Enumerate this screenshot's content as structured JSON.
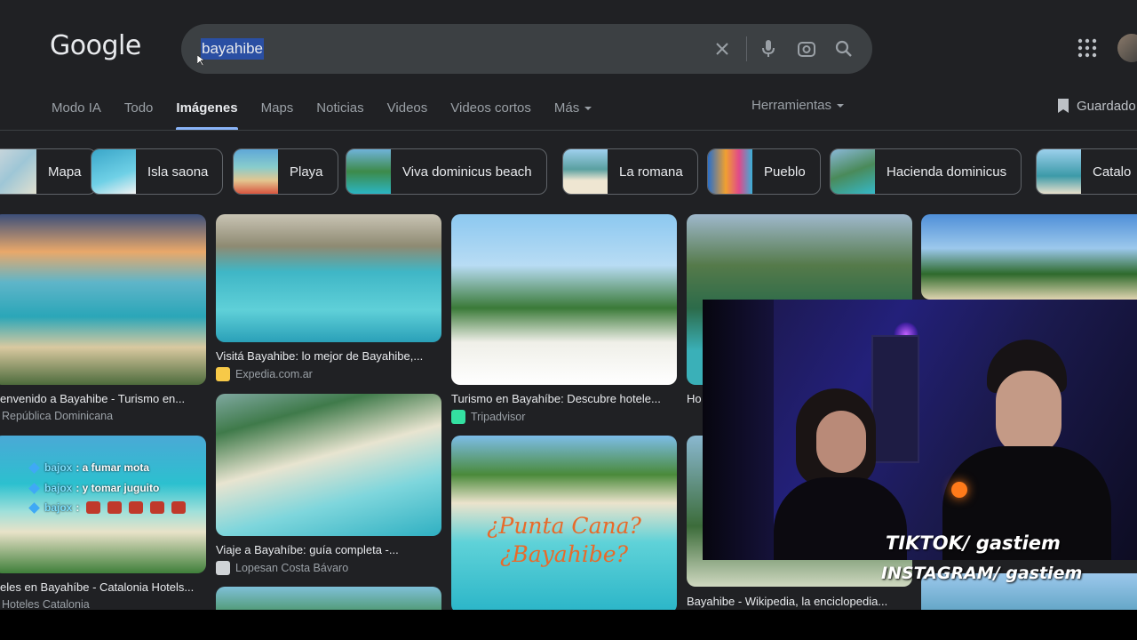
{
  "header": {
    "logo": "Google",
    "search_query": "bayahibe",
    "icons": [
      "close-icon",
      "mic-icon",
      "lens-icon",
      "search-icon",
      "apps-grid-icon"
    ]
  },
  "tabs": [
    {
      "label": "Modo IA",
      "active": false
    },
    {
      "label": "Todo",
      "active": false
    },
    {
      "label": "Imágenes",
      "active": true
    },
    {
      "label": "Maps",
      "active": false
    },
    {
      "label": "Noticias",
      "active": false
    },
    {
      "label": "Videos",
      "active": false
    },
    {
      "label": "Videos cortos",
      "active": false
    },
    {
      "label": "Más",
      "active": false
    }
  ],
  "tools_label": "Herramientas",
  "saved_label": "Guardado",
  "chips": [
    {
      "label": "Mapa"
    },
    {
      "label": "Isla saona"
    },
    {
      "label": "Playa"
    },
    {
      "label": "Viva dominicus beach"
    },
    {
      "label": "La romana"
    },
    {
      "label": "Pueblo"
    },
    {
      "label": "Hacienda dominicus"
    },
    {
      "label": "Catalo"
    }
  ],
  "results": [
    {
      "caption": "envenido a Bayahibe - Turismo en...",
      "source": "República Dominicana"
    },
    {
      "caption": "Visitá Bayahibe: lo mejor de Bayahibe,...",
      "source": "Expedia.com.ar"
    },
    {
      "caption": "Turismo en Bayahíbe: Descubre hotele...",
      "source": "Tripadvisor"
    },
    {
      "caption": "Ho",
      "source": ""
    },
    {
      "caption": "Viaje a Bayahíbe: guía completa -...",
      "source": "Lopesan Costa Bávaro"
    },
    {
      "caption": "eles en Bayahíbe - Catalonia Hotels...",
      "source": "Hoteles Catalonia"
    },
    {
      "caption": "Bayahibe - Wikipedia, la enciclopedia...",
      "source": ""
    }
  ],
  "image_texts": {
    "punta_cana_line1": "¿Punta Cana?",
    "punta_cana_line2": "¿Bayahibe?"
  },
  "chat": [
    {
      "user": "bajox",
      "message": ": a fumar mota"
    },
    {
      "user": "bajox",
      "message": ": y tomar juguito"
    },
    {
      "user": "bajox",
      "message": ":"
    }
  ],
  "overlay": {
    "tiktok": "TIKTOK/ gastiem",
    "instagram": "INSTAGRAM/ gastiem"
  },
  "colors": {
    "background": "#202124",
    "accent": "#8ab4f8",
    "selection": "#2a4fa3"
  }
}
